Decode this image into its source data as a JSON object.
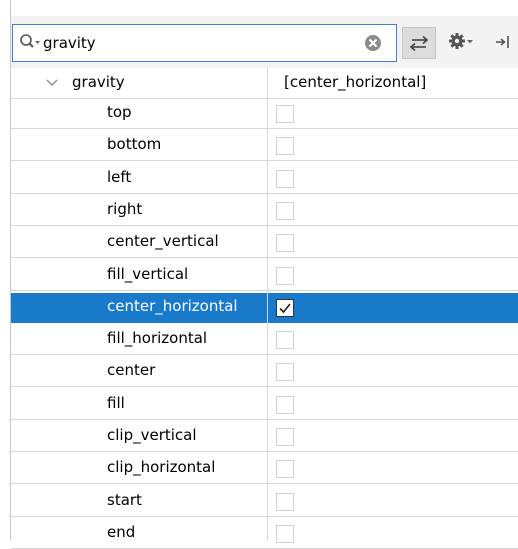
{
  "search": {
    "value": "gravity",
    "icon": "search-icon",
    "clear_icon": "clear-icon"
  },
  "toolbar": {
    "buttons": [
      "sync-icon",
      "gear-icon",
      "collapse-icon"
    ]
  },
  "property": {
    "name": "gravity",
    "value": "[center_horizontal]",
    "expanded": true
  },
  "flags": [
    {
      "label": "top",
      "checked": false
    },
    {
      "label": "bottom",
      "checked": false
    },
    {
      "label": "left",
      "checked": false
    },
    {
      "label": "right",
      "checked": false
    },
    {
      "label": "center_vertical",
      "checked": false
    },
    {
      "label": "fill_vertical",
      "checked": false
    },
    {
      "label": "center_horizontal",
      "checked": true,
      "selected": true
    },
    {
      "label": "fill_horizontal",
      "checked": false
    },
    {
      "label": "center",
      "checked": false
    },
    {
      "label": "fill",
      "checked": false
    },
    {
      "label": "clip_vertical",
      "checked": false
    },
    {
      "label": "clip_horizontal",
      "checked": false
    },
    {
      "label": "start",
      "checked": false
    },
    {
      "label": "end",
      "checked": false
    }
  ],
  "colors": {
    "selection": "#1979ca",
    "search_border": "#3c7fd3",
    "grid": "#d6d6d6"
  }
}
